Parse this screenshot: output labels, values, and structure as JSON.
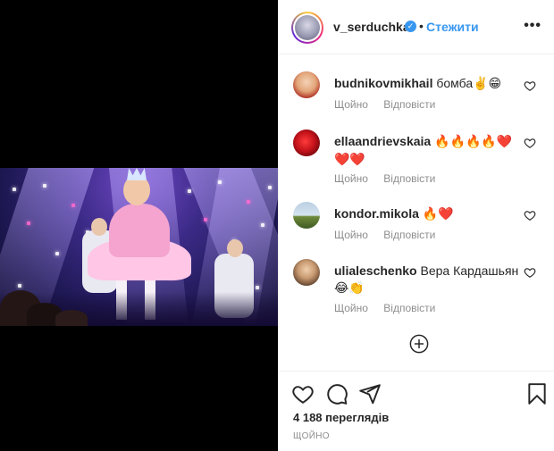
{
  "post": {
    "username": "v_serduchka",
    "separator": "•",
    "follow_label": "Стежити",
    "more_label": "•••",
    "verified_mark": "✓"
  },
  "comments": [
    {
      "user": "budnikovmikhail",
      "text": "бомба",
      "emoji": "✌️😁",
      "meta": {
        "time": "Щойно",
        "reply": "Відповісти"
      }
    },
    {
      "user": "ellaandrievskaia",
      "text": "",
      "emoji": "🔥🔥🔥🔥❤️❤️❤️",
      "meta": {
        "time": "Щойно",
        "reply": "Відповісти"
      }
    },
    {
      "user": "kondor.mikola",
      "text": "",
      "emoji": "🔥❤️",
      "meta": {
        "time": "Щойно",
        "reply": "Відповісти"
      }
    },
    {
      "user": "ulialeschenko",
      "text": "Вера Кардашьян",
      "emoji": "😂👏",
      "meta": {
        "time": "Щойно",
        "reply": "Відповісти"
      }
    }
  ],
  "footer": {
    "views": "4 188 переглядів",
    "time": "ЩОЙНО"
  },
  "icons": {
    "like": "heart-icon",
    "comment": "comment-icon",
    "share": "share-icon",
    "save": "bookmark-icon",
    "load_more": "plus-circle-icon"
  },
  "colors": {
    "link": "#3897f0",
    "muted": "#8e8e8e",
    "text": "#262626",
    "divider": "#efefef"
  }
}
